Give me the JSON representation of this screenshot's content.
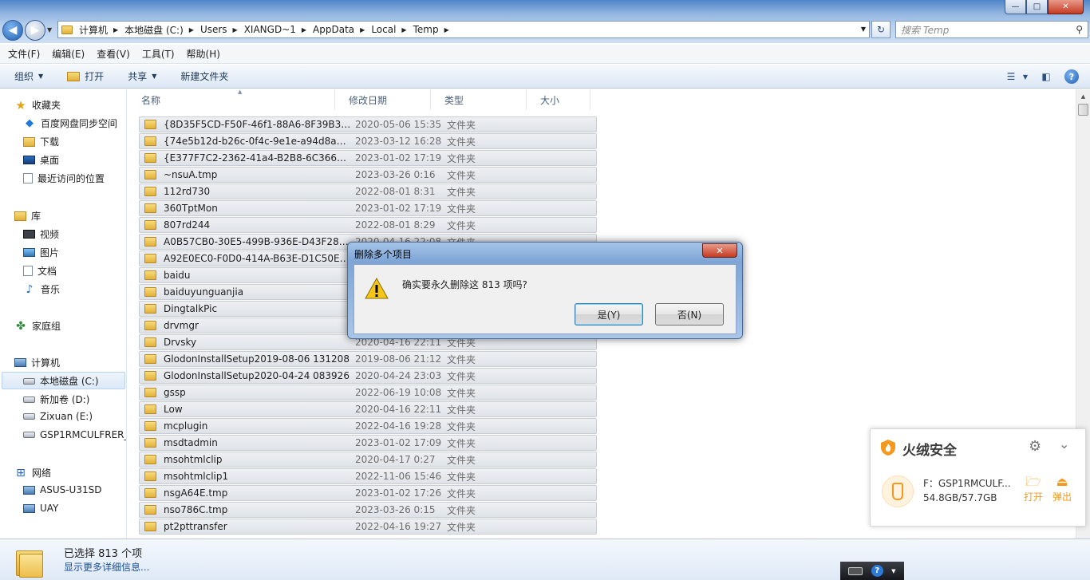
{
  "window": {
    "controls": {
      "minimize": "—",
      "maximize": "□",
      "close": "✕"
    }
  },
  "address": {
    "crumbs": [
      "计算机",
      "本地磁盘 (C:)",
      "Users",
      "XIANGD~1",
      "AppData",
      "Local",
      "Temp"
    ]
  },
  "search": {
    "placeholder": "搜索 Temp"
  },
  "menubar": {
    "items": [
      "文件(F)",
      "编辑(E)",
      "查看(V)",
      "工具(T)",
      "帮助(H)"
    ]
  },
  "commandbar": {
    "organize": "组织",
    "open": "打开",
    "share": "共享",
    "new_folder": "新建文件夹"
  },
  "navpane": {
    "favorites": {
      "label": "收藏夹",
      "items": [
        "百度网盘同步空间",
        "下载",
        "桌面",
        "最近访问的位置"
      ]
    },
    "libraries": {
      "label": "库",
      "items": [
        "视频",
        "图片",
        "文档",
        "音乐"
      ]
    },
    "homegroup": {
      "label": "家庭组"
    },
    "computer": {
      "label": "计算机",
      "items": [
        "本地磁盘 (C:)",
        "新加卷 (D:)",
        "Zixuan (E:)",
        "GSP1RMCULFRER_"
      ]
    },
    "network": {
      "label": "网络",
      "items": [
        "ASUS-U31SD",
        "UAY"
      ]
    }
  },
  "columns": {
    "name": "名称",
    "date": "修改日期",
    "type": "类型",
    "size": "大小"
  },
  "files": [
    {
      "name": "{8D35F5CD-F50F-46f1-88A6-8F39B31...",
      "date": "2020-05-06 15:35",
      "type": "文件夹"
    },
    {
      "name": "{74e5b12d-b26c-0f4c-9e1e-a94d8ae...",
      "date": "2023-03-12 16:28",
      "type": "文件夹"
    },
    {
      "name": "{E377F7C2-2362-41a4-B2B8-6C3660E...",
      "date": "2023-01-02 17:19",
      "type": "文件夹"
    },
    {
      "name": "~nsuA.tmp",
      "date": "2023-03-26 0:16",
      "type": "文件夹"
    },
    {
      "name": "112rd730",
      "date": "2022-08-01 8:31",
      "type": "文件夹"
    },
    {
      "name": "360TptMon",
      "date": "2023-01-02 17:19",
      "type": "文件夹"
    },
    {
      "name": "807rd244",
      "date": "2022-08-01 8:29",
      "type": "文件夹"
    },
    {
      "name": "A0B57CB0-30E5-499B-936E-D43F282...",
      "date": "2020-04-16 22:08",
      "type": "文件夹"
    },
    {
      "name": "A92E0EC0-F0D0-414A-B63E-D1C50E6...",
      "date": "",
      "type": ""
    },
    {
      "name": "baidu",
      "date": "",
      "type": ""
    },
    {
      "name": "baiduyunguanjia",
      "date": "",
      "type": ""
    },
    {
      "name": "DingtalkPic",
      "date": "",
      "type": ""
    },
    {
      "name": "drvmgr",
      "date": "",
      "type": ""
    },
    {
      "name": "Drvsky",
      "date": "2020-04-16 22:11",
      "type": "文件夹"
    },
    {
      "name": "GlodonInstallSetup2019-08-06 131208",
      "date": "2019-08-06 21:12",
      "type": "文件夹"
    },
    {
      "name": "GlodonInstallSetup2020-04-24 083926",
      "date": "2020-04-24 23:03",
      "type": "文件夹"
    },
    {
      "name": "gssp",
      "date": "2022-06-19 10:08",
      "type": "文件夹"
    },
    {
      "name": "Low",
      "date": "2020-04-16 22:11",
      "type": "文件夹"
    },
    {
      "name": "mcplugin",
      "date": "2022-04-16 19:28",
      "type": "文件夹"
    },
    {
      "name": "msdtadmin",
      "date": "2023-01-02 17:09",
      "type": "文件夹"
    },
    {
      "name": "msohtmlclip",
      "date": "2020-04-17 0:27",
      "type": "文件夹"
    },
    {
      "name": "msohtmlclip1",
      "date": "2022-11-06 15:46",
      "type": "文件夹"
    },
    {
      "name": "nsgA64E.tmp",
      "date": "2023-01-02 17:26",
      "type": "文件夹"
    },
    {
      "name": "nso786C.tmp",
      "date": "2023-03-26 0:15",
      "type": "文件夹"
    },
    {
      "name": "pt2pttransfer",
      "date": "2022-04-16 19:27",
      "type": "文件夹"
    }
  ],
  "details": {
    "selected": "已选择 813 个项",
    "more_info": "显示更多详细信息..."
  },
  "dialog": {
    "title": "删除多个项目",
    "close": "✕",
    "message": "确实要永久删除这 813 项吗?",
    "yes": "是(Y)",
    "no": "否(N)"
  },
  "security_popup": {
    "title": "火绒安全",
    "drive": "F：GSP1RMCULF...",
    "size": "54.8GB/57.7GB",
    "open": "打开",
    "eject": "弹出",
    "accent_color": "#f39a1e"
  },
  "tray": {
    "help": "?"
  }
}
